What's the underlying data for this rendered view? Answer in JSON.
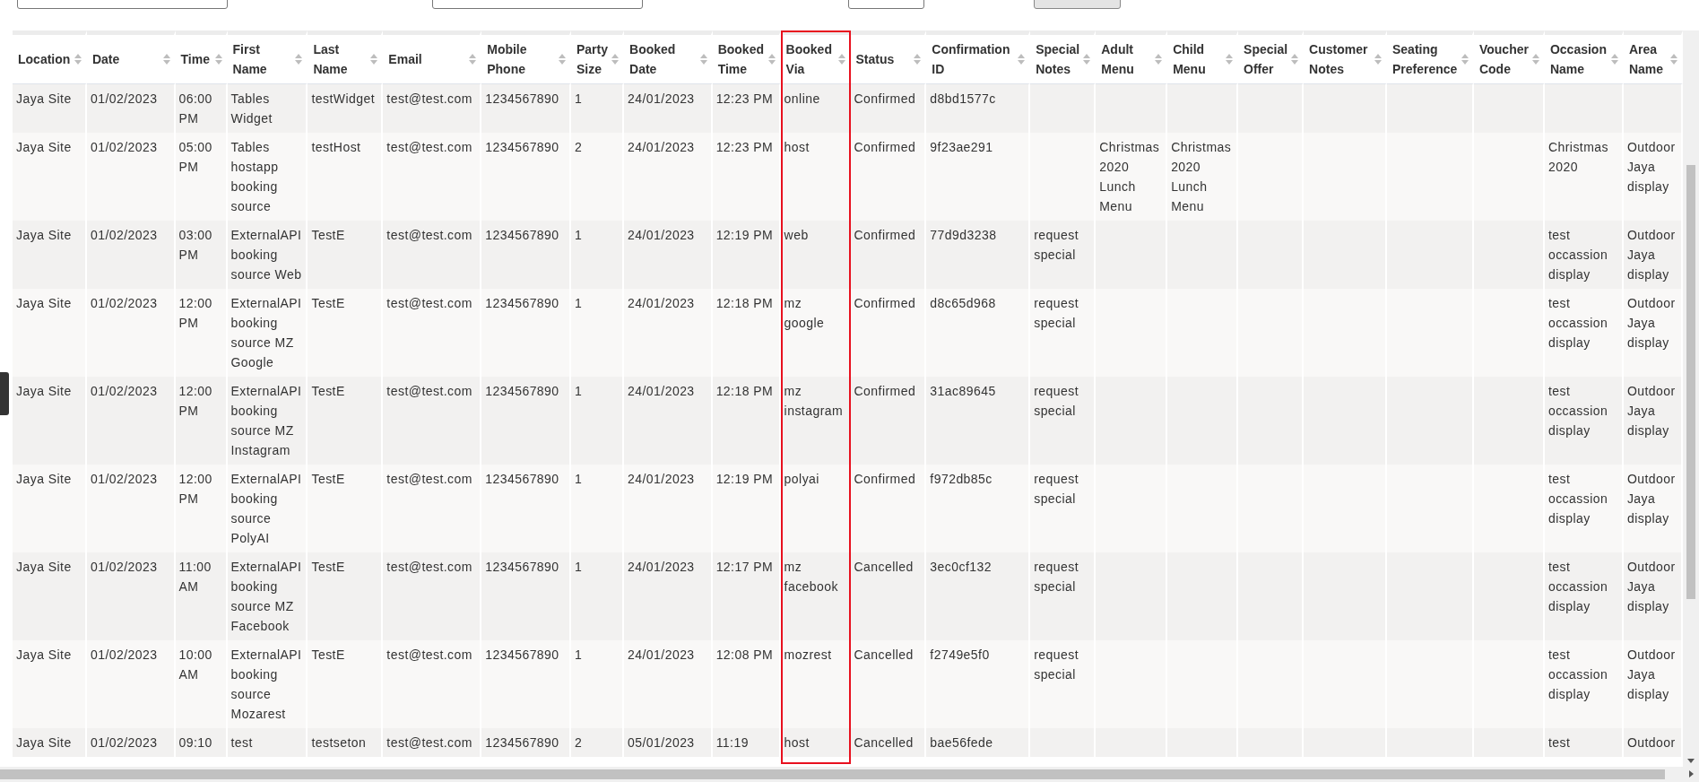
{
  "columns": [
    {
      "label": "Location",
      "highlighted": false
    },
    {
      "label": "Date",
      "highlighted": false
    },
    {
      "label": "Time",
      "highlighted": false
    },
    {
      "label": "First Name",
      "highlighted": false
    },
    {
      "label": "Last Name",
      "highlighted": false
    },
    {
      "label": "Email",
      "highlighted": false
    },
    {
      "label": "Mobile Phone",
      "highlighted": false
    },
    {
      "label": "Party Size",
      "highlighted": false
    },
    {
      "label": "Booked Date",
      "highlighted": false
    },
    {
      "label": "Booked Time",
      "highlighted": false
    },
    {
      "label": "Booked Via",
      "highlighted": true
    },
    {
      "label": "Status",
      "highlighted": false
    },
    {
      "label": "Confirmation ID",
      "highlighted": false
    },
    {
      "label": "Special Notes",
      "highlighted": false
    },
    {
      "label": "Adult Menu",
      "highlighted": false
    },
    {
      "label": "Child Menu",
      "highlighted": false
    },
    {
      "label": "Special Offer",
      "highlighted": false
    },
    {
      "label": "Customer Notes",
      "highlighted": false
    },
    {
      "label": "Seating Preference",
      "highlighted": false
    },
    {
      "label": "Voucher Code",
      "highlighted": false
    },
    {
      "label": "Occasion Name",
      "highlighted": false
    },
    {
      "label": "Area Name",
      "highlighted": false
    }
  ],
  "rows": [
    [
      "Jaya Site",
      "01/02/2023",
      "06:00 PM",
      "Tables Widget",
      "testWidget",
      "test@test.com",
      "1234567890",
      "1",
      "24/01/2023",
      "12:23 PM",
      "online",
      "Confirmed",
      "d8bd1577c",
      null,
      null,
      null,
      null,
      null,
      null,
      null,
      null,
      null
    ],
    [
      "Jaya Site",
      "01/02/2023",
      "05:00 PM",
      "Tables hostapp booking source",
      "testHost",
      "test@test.com",
      "1234567890",
      "2",
      "24/01/2023",
      "12:23 PM",
      "host",
      "Confirmed",
      "9f23ae291",
      null,
      "Christmas 2020 Lunch Menu",
      "Christmas 2020 Lunch Menu",
      null,
      null,
      null,
      null,
      "Christmas 2020",
      "Outdoor Jaya display"
    ],
    [
      "Jaya Site",
      "01/02/2023",
      "03:00 PM",
      "ExternalAPI booking source Web",
      "TestE",
      "test@test.com",
      "1234567890",
      "1",
      "24/01/2023",
      "12:19 PM",
      "web",
      "Confirmed",
      "77d9d3238",
      "request special",
      null,
      null,
      null,
      null,
      null,
      null,
      "test occassion display",
      "Outdoor Jaya display"
    ],
    [
      "Jaya Site",
      "01/02/2023",
      "12:00 PM",
      "ExternalAPI booking source MZ Google",
      "TestE",
      "test@test.com",
      "1234567890",
      "1",
      "24/01/2023",
      "12:18 PM",
      "mz google",
      "Confirmed",
      "d8c65d968",
      "request special",
      null,
      null,
      null,
      null,
      null,
      null,
      "test occassion display",
      "Outdoor Jaya display"
    ],
    [
      "Jaya Site",
      "01/02/2023",
      "12:00 PM",
      "ExternalAPI booking source MZ Instagram",
      "TestE",
      "test@test.com",
      "1234567890",
      "1",
      "24/01/2023",
      "12:18 PM",
      "mz instagram",
      "Confirmed",
      "31ac89645",
      "request special",
      null,
      null,
      null,
      null,
      null,
      null,
      "test occassion display",
      "Outdoor Jaya display"
    ],
    [
      "Jaya Site",
      "01/02/2023",
      "12:00 PM",
      "ExternalAPI booking source PolyAI",
      "TestE",
      "test@test.com",
      "1234567890",
      "1",
      "24/01/2023",
      "12:19 PM",
      "polyai",
      "Confirmed",
      "f972db85c",
      "request special",
      null,
      null,
      null,
      null,
      null,
      null,
      "test occassion display",
      "Outdoor Jaya display"
    ],
    [
      "Jaya Site",
      "01/02/2023",
      "11:00 AM",
      "ExternalAPI booking source MZ Facebook",
      "TestE",
      "test@test.com",
      "1234567890",
      "1",
      "24/01/2023",
      "12:17 PM",
      "mz facebook",
      "Cancelled",
      "3ec0cf132",
      "request special",
      null,
      null,
      null,
      null,
      null,
      null,
      "test occassion display",
      "Outdoor Jaya display"
    ],
    [
      "Jaya Site",
      "01/02/2023",
      "10:00 AM",
      "ExternalAPI booking source Mozarest",
      "TestE",
      "test@test.com",
      "1234567890",
      "1",
      "24/01/2023",
      "12:08 PM",
      "mozrest",
      "Cancelled",
      "f2749e5f0",
      "request special",
      null,
      null,
      null,
      null,
      null,
      null,
      "test occassion display",
      "Outdoor Jaya display"
    ],
    [
      "Jaya Site",
      "01/02/2023",
      "09:10",
      "test",
      "testseton",
      "test@test.com",
      "1234567890",
      "2",
      "05/01/2023",
      "11:19",
      "host",
      "Cancelled",
      "bae56fede",
      null,
      null,
      null,
      null,
      null,
      null,
      null,
      "test",
      "Outdoor"
    ]
  ]
}
